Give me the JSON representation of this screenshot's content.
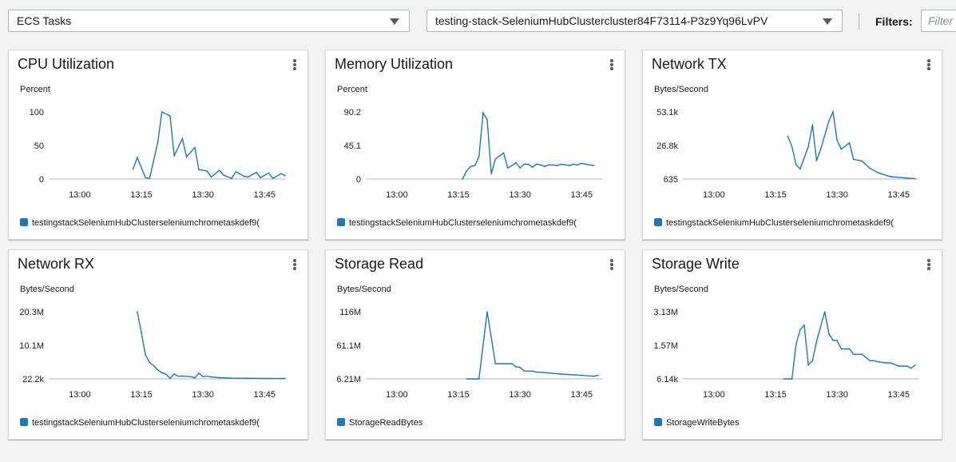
{
  "toolbar": {
    "resource_select": "ECS Tasks",
    "cluster_select": "testing-stack-SeleniumHubClustercluster84F73114-P3z9Yq96LvPV",
    "filters_label": "Filters:",
    "filter_placeholder": "Filter"
  },
  "widgets": [
    {
      "title": "CPU Utilization",
      "unit": "Percent",
      "legend": "testingstackSeleniumHubClusterseleniumchrometaskdef9(",
      "chart_data": {
        "type": "line",
        "yticks": [
          "100",
          "50",
          "0"
        ],
        "ylim": [
          0,
          100
        ],
        "xticks": [
          "13:00",
          "13:15",
          "13:30",
          "13:45"
        ],
        "series": [
          {
            "name": "testingstackSeleniumHubClusterseleniumchrometaskdef9(",
            "x": [
              13.13,
              13.14,
              13.16,
              13.17,
              13.19,
              13.2,
              13.22,
              13.23,
              13.25,
              13.26,
              13.28,
              13.29,
              13.31,
              13.32,
              13.34,
              13.35,
              13.37,
              13.38,
              13.4,
              13.41,
              13.43,
              13.44,
              13.46,
              13.47,
              13.49,
              13.5
            ],
            "y": [
              15,
              32,
              2,
              1,
              55,
              100,
              94,
              35,
              60,
              33,
              47,
              14,
              12,
              3,
              13,
              6,
              1,
              11,
              4,
              3,
              10,
              2,
              9,
              1,
              8,
              5
            ]
          }
        ]
      }
    },
    {
      "title": "Memory Utilization",
      "unit": "Percent",
      "legend": "testingstackSeleniumHubClusterseleniumchrometaskdef9(",
      "chart_data": {
        "type": "line",
        "yticks": [
          "90.2",
          "45.1",
          "0"
        ],
        "ylim": [
          0,
          90.2
        ],
        "xticks": [
          "13:00",
          "13:15",
          "13:30",
          "13:45"
        ],
        "series": [
          {
            "name": "testingstackSeleniumHubClusterseleniumchrometaskdef9(",
            "x": [
              13.16,
              13.17,
              13.18,
              13.19,
              13.2,
              13.21,
              13.22,
              13.23,
              13.24,
              13.25,
              13.26,
              13.27,
              13.28,
              13.29,
              13.3,
              13.31,
              13.32,
              13.33,
              13.34,
              13.35,
              13.36,
              13.37,
              13.38,
              13.39,
              13.4,
              13.41,
              13.42,
              13.43,
              13.44,
              13.45,
              13.46,
              13.47,
              13.48
            ],
            "y": [
              0,
              11,
              17,
              18,
              30,
              89,
              80,
              7,
              27,
              31,
              35,
              15,
              18,
              22,
              15,
              20,
              20,
              16,
              20,
              19,
              17,
              19,
              19,
              18,
              20,
              19,
              18,
              20,
              19,
              21,
              20,
              19,
              18
            ]
          }
        ]
      }
    },
    {
      "title": "Network TX",
      "unit": "Bytes/Second",
      "legend": "testingstackSeleniumHubClusterseleniumchrometaskdef9(",
      "chart_data": {
        "type": "line",
        "yticks": [
          "53.1k",
          "26.8k",
          "635"
        ],
        "ylim": [
          635,
          53100
        ],
        "xticks": [
          "13:00",
          "13:15",
          "13:30",
          "13:45"
        ],
        "series": [
          {
            "name": "testingstackSeleniumHubClusterseleniumchrometaskdef9(",
            "x": [
              13.18,
              13.19,
              13.2,
              13.21,
              13.23,
              13.24,
              13.25,
              13.26,
              13.28,
              13.29,
              13.3,
              13.31,
              13.33,
              13.34,
              13.36,
              13.38,
              13.4,
              13.43,
              13.47,
              13.49
            ],
            "y": [
              34000,
              26000,
              12000,
              8500,
              26000,
              43000,
              15000,
              24000,
              46000,
              53100,
              31000,
              24000,
              28800,
              16000,
              14800,
              9000,
              5500,
              2500,
              1400,
              1000
            ]
          }
        ]
      }
    },
    {
      "title": "Network RX",
      "unit": "Bytes/Second",
      "legend": "testingstackSeleniumHubClusterseleniumchrometaskdef9(",
      "chart_data": {
        "type": "line",
        "yticks": [
          "20.3M",
          "10.1M",
          "22.2k"
        ],
        "ylim": [
          22200,
          20300000
        ],
        "xticks": [
          "13:00",
          "13:15",
          "13:30",
          "13:45"
        ],
        "series": [
          {
            "name": "testingstackSeleniumHubClusterseleniumchrometaskdef9(",
            "x": [
              13.14,
              13.15,
              13.16,
              13.17,
              13.18,
              13.19,
              13.2,
              13.21,
              13.22,
              13.23,
              13.24,
              13.25,
              13.27,
              13.28,
              13.29,
              13.3,
              13.31,
              13.32,
              13.34,
              13.37,
              13.45,
              13.5
            ],
            "y": [
              20300000,
              14000000,
              7300000,
              5000000,
              4000000,
              2700000,
              1900000,
              1400000,
              160000,
              1500000,
              800000,
              900000,
              700000,
              300000,
              1700000,
              700000,
              850000,
              600000,
              380000,
              230000,
              150000,
              120000
            ]
          }
        ]
      }
    },
    {
      "title": "Storage Read",
      "unit": "Bytes/Second",
      "legend": "StorageReadBytes",
      "chart_data": {
        "type": "line",
        "yticks": [
          "116M",
          "61.1M",
          "6.21M"
        ],
        "ylim": [
          6210000,
          116000000
        ],
        "xticks": [
          "13:00",
          "13:15",
          "13:30",
          "13:45"
        ],
        "series": [
          {
            "name": "StorageReadBytes",
            "x": [
              13.17,
              13.2,
              13.22,
              13.24,
              13.26,
              13.28,
              13.29,
              13.3,
              13.31,
              13.33,
              13.34,
              13.35,
              13.4,
              13.45,
              13.48,
              13.49
            ],
            "y": [
              6210000,
              6210000,
              116000000,
              31000000,
              31000000,
              31000000,
              26000000,
              25000000,
              19000000,
              19000000,
              17000000,
              17000000,
              14000000,
              12000000,
              10500000,
              12000000
            ]
          }
        ]
      }
    },
    {
      "title": "Storage Write",
      "unit": "Bytes/Second",
      "legend": "StorageWriteBytes",
      "chart_data": {
        "type": "line",
        "yticks": [
          "3.13M",
          "1.57M",
          "6.14k"
        ],
        "ylim": [
          6140,
          3130000
        ],
        "xticks": [
          "13:00",
          "13:15",
          "13:30",
          "13:45"
        ],
        "series": [
          {
            "name": "StorageWriteBytes",
            "x": [
              13.17,
              13.19,
              13.2,
              13.21,
              13.22,
              13.23,
              13.24,
              13.25,
              13.27,
              13.28,
              13.29,
              13.3,
              13.31,
              13.32,
              13.33,
              13.34,
              13.36,
              13.38,
              13.39,
              13.4,
              13.42,
              13.43,
              13.45,
              13.46,
              13.47,
              13.48,
              13.49
            ],
            "y": [
              6140,
              6140,
              1600000,
              2300000,
              2500000,
              650000,
              850000,
              1750000,
              3130000,
              2100000,
              1800000,
              1800000,
              1400000,
              1400000,
              1400000,
              1150000,
              1150000,
              850000,
              850000,
              800000,
              750000,
              750000,
              600000,
              600000,
              600000,
              500000,
              650000
            ]
          }
        ]
      }
    }
  ]
}
